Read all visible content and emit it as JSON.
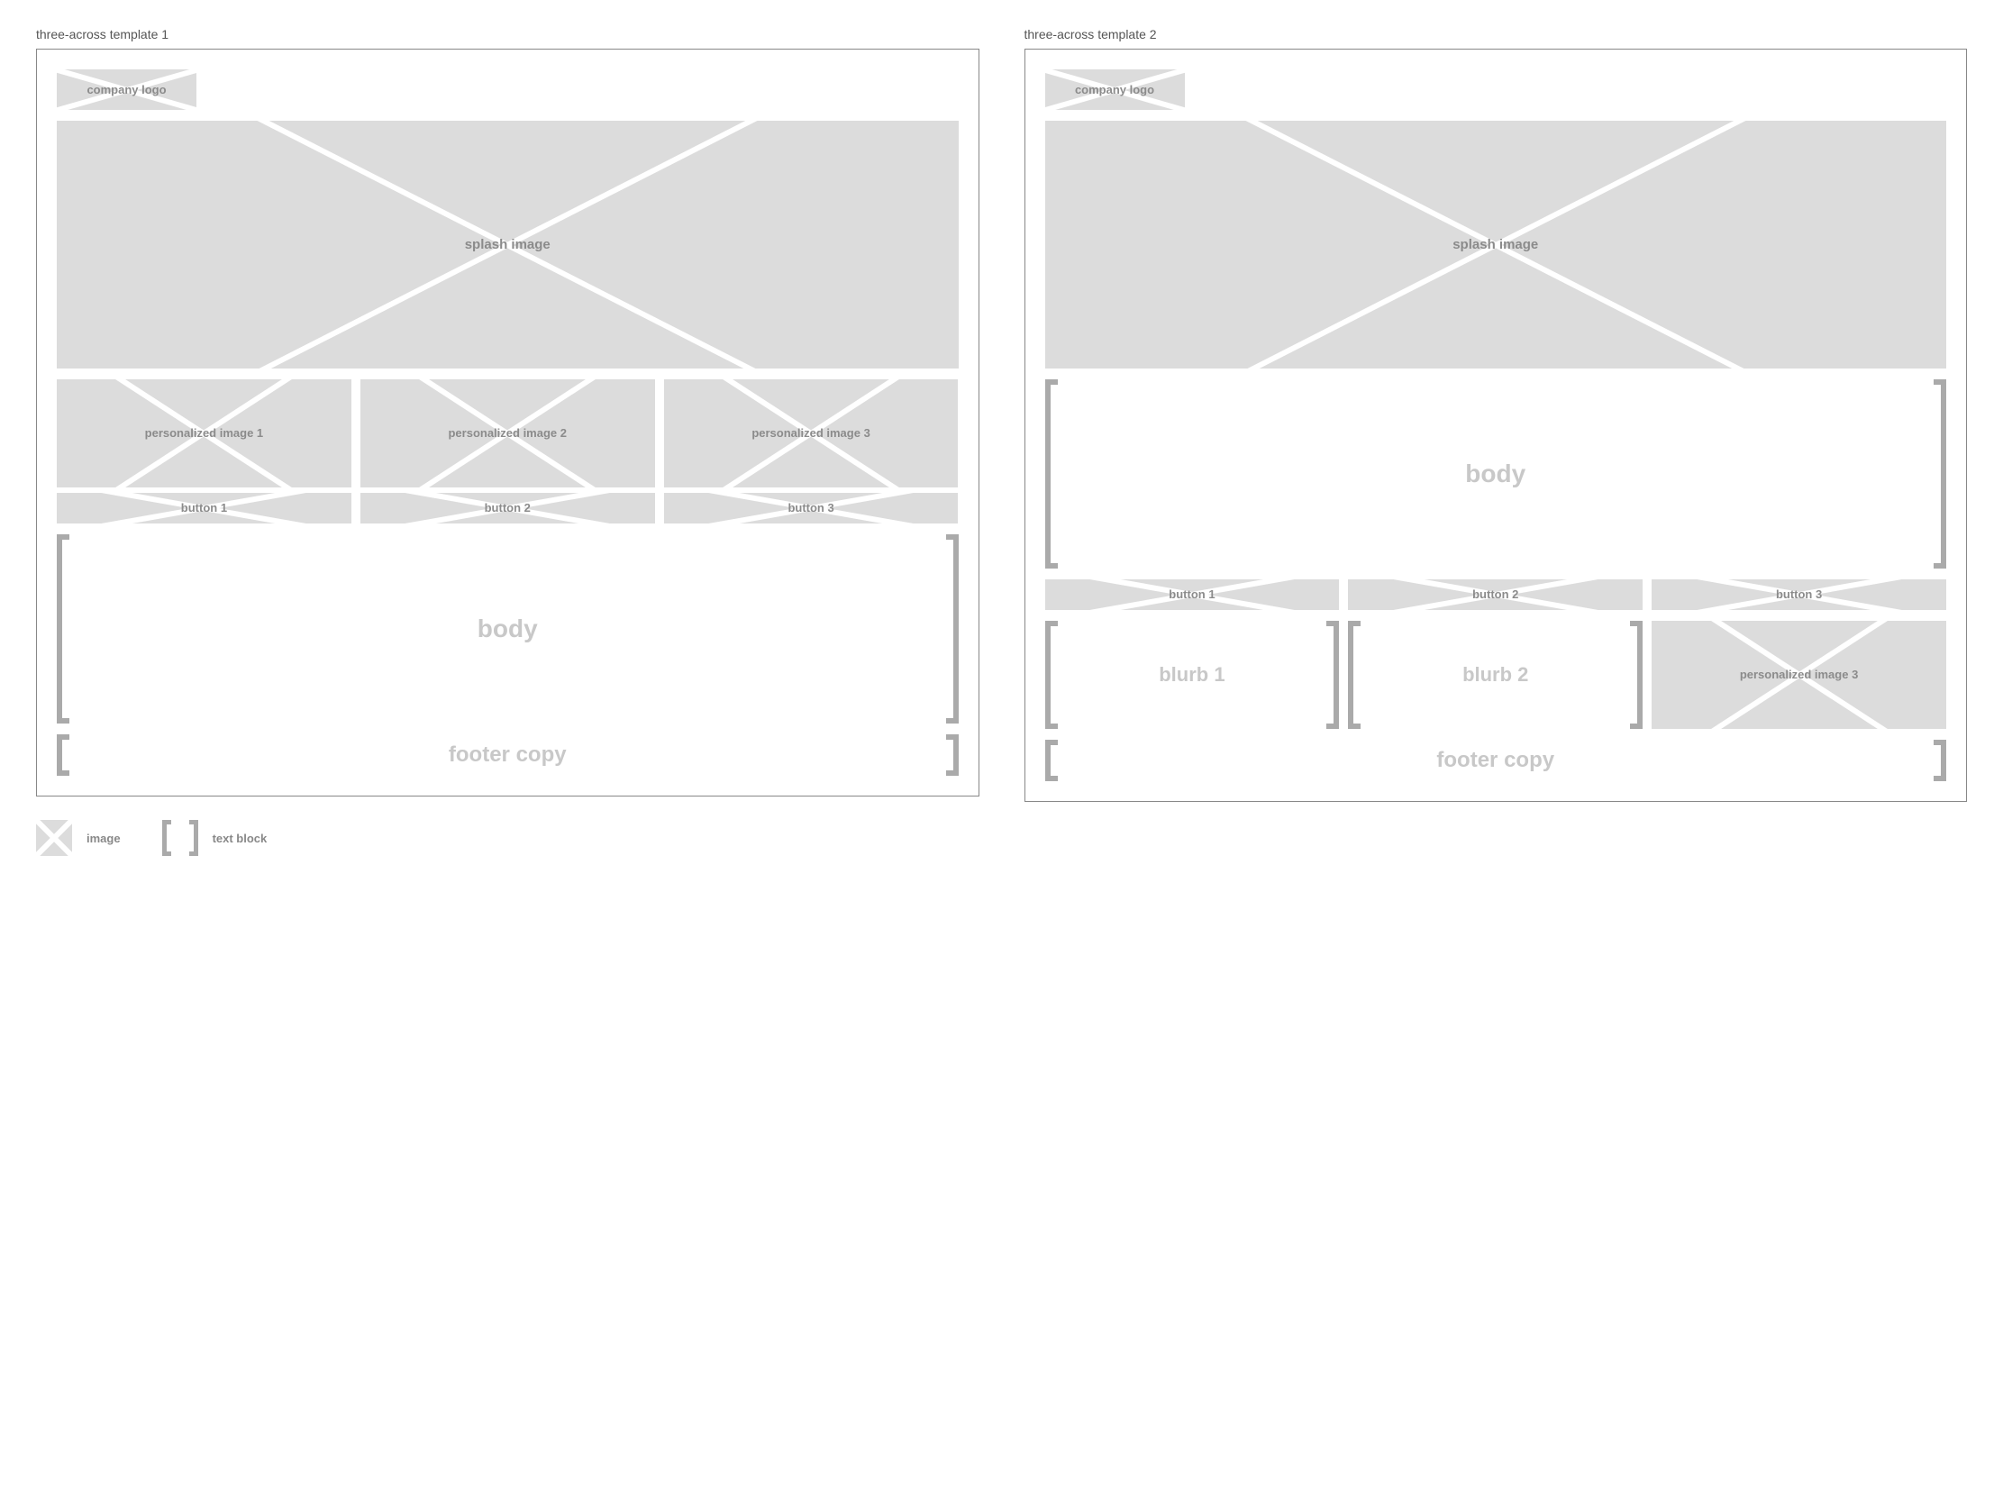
{
  "templates": [
    {
      "title": "three-across template 1",
      "logo": "company logo",
      "splash": "splash image",
      "personalized": [
        "personalized image 1",
        "personalized image 2",
        "personalized image 3"
      ],
      "buttons": [
        "button 1",
        "button 2",
        "button 3"
      ],
      "body": "body",
      "footer": "footer copy"
    },
    {
      "title": "three-across template 2",
      "logo": "company logo",
      "splash": "splash image",
      "body": "body",
      "buttons": [
        "button 1",
        "button 2",
        "button 3"
      ],
      "blurbs": [
        "blurb 1",
        "blurb 2"
      ],
      "personalized_single": "personalized image 3",
      "footer": "footer copy"
    }
  ],
  "legend": {
    "image": "image",
    "text": "text block"
  }
}
